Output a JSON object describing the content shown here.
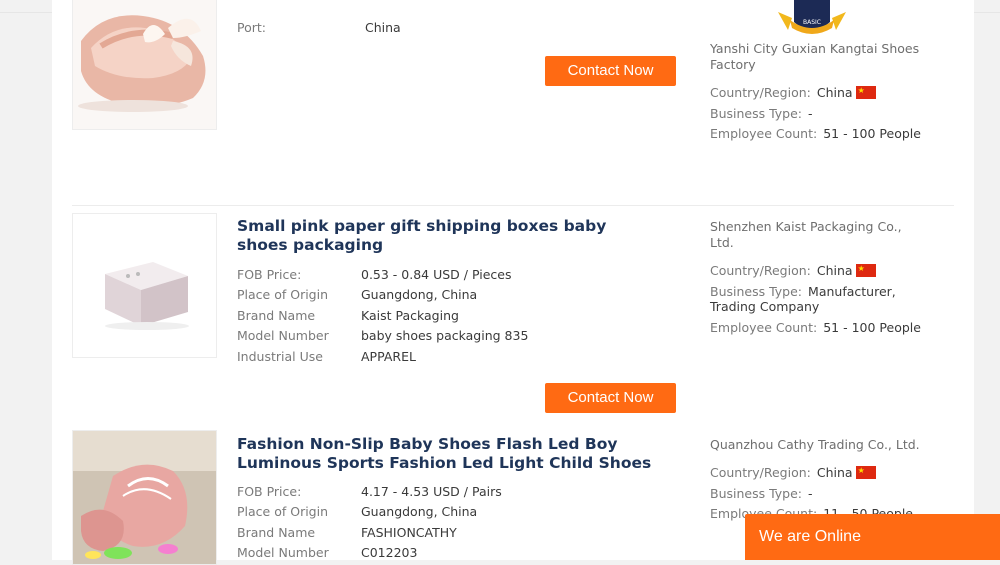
{
  "listings": [
    {
      "title": "",
      "attrs": [
        {
          "label": "Port:",
          "value": "China"
        }
      ],
      "contact_label": "Contact Now",
      "supplier": {
        "company": "Yanshi City Guxian Kangtai Shoes Factory",
        "badge_text": "BASIC",
        "country_label": "Country/Region:",
        "country": "China",
        "business_label": "Business Type:",
        "business": "-",
        "employee_label": "Employee Count:",
        "employee": "51 - 100 People"
      }
    },
    {
      "title": "Small pink paper gift shipping boxes baby shoes packaging",
      "attrs": [
        {
          "label": "FOB Price:",
          "value": "0.53 - 0.84 USD / Pieces"
        },
        {
          "label": "Place of Origin",
          "value": "Guangdong, China"
        },
        {
          "label": "Brand Name",
          "value": "Kaist Packaging"
        },
        {
          "label": "Model Number",
          "value": "baby shoes packaging 835"
        },
        {
          "label": "Industrial Use",
          "value": "APPAREL"
        }
      ],
      "contact_label": "Contact Now",
      "supplier": {
        "company": "Shenzhen Kaist Packaging Co., Ltd.",
        "country_label": "Country/Region:",
        "country": "China",
        "business_label": "Business Type:",
        "business": "Manufacturer, Trading Company",
        "employee_label": "Employee Count:",
        "employee": "51 - 100 People"
      }
    },
    {
      "title": "Fashion Non-Slip Baby Shoes Flash Led Boy Luminous Sports Fashion Led Light Child Shoes",
      "attrs": [
        {
          "label": "FOB Price:",
          "value": "4.17 - 4.53 USD / Pairs"
        },
        {
          "label": "Place of Origin",
          "value": "Guangdong, China"
        },
        {
          "label": "Brand Name",
          "value": "FASHIONCATHY"
        },
        {
          "label": "Model Number",
          "value": "C012203"
        }
      ],
      "supplier": {
        "company": "Quanzhou Cathy Trading Co., Ltd.",
        "country_label": "Country/Region:",
        "country": "China",
        "business_label": "Business Type:",
        "business": "-",
        "employee_label": "Employee Count:",
        "employee": "11 - 50 People"
      }
    }
  ],
  "chat": {
    "label": "We are Online"
  },
  "colors": {
    "accent": "#ff6a13",
    "title": "#1f3559"
  }
}
